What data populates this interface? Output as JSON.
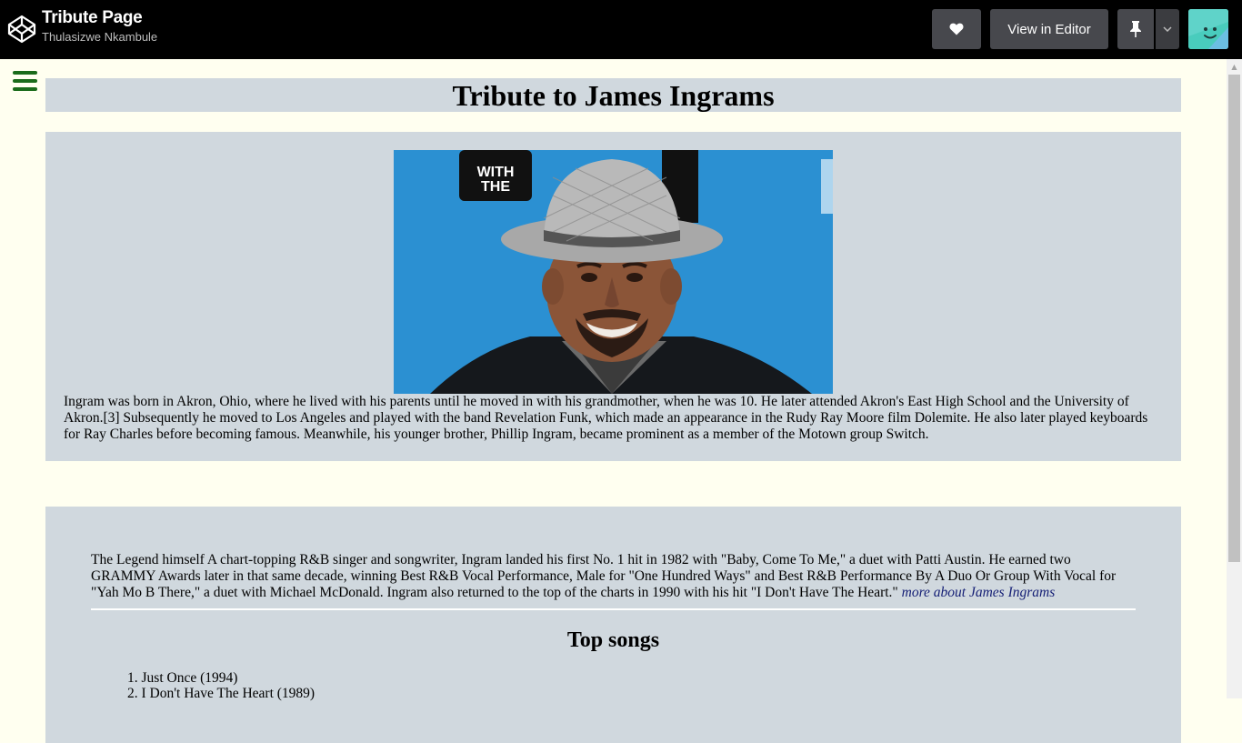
{
  "codepen": {
    "title": "Tribute Page",
    "author": "Thulasizwe Nkambule",
    "heart_icon": "heart-icon",
    "view_in_editor": "View in Editor",
    "pin_icon": "pin-icon"
  },
  "page": {
    "heading": "Tribute to James Ingrams",
    "photo_badge_line1": "WITH",
    "photo_badge_line2": "THE",
    "bio": "Ingram was born in Akron, Ohio, where he lived with his parents until he moved in with his grandmother, when he was 10. He later attended Akron's East High School and the University of Akron.[3] Subsequently he moved to Los Angeles and played with the band Revelation Funk, which made an appearance in the Rudy Ray Moore film Dolemite. He also later played keyboards for Ray Charles before becoming famous. Meanwhile, his younger brother, Phillip Ingram, became prominent as a member of the Motown group Switch.",
    "quote": "The Legend himself A chart-topping R&B singer and songwriter, Ingram landed his first No. 1 hit in 1982 with \"Baby, Come To Me,\" a duet with Patti Austin. He earned two GRAMMY Awards later in that same decade, winning Best R&B Vocal Performance, Male for \"One Hundred Ways\" and Best R&B Performance By A Duo Or Group With Vocal for \"Yah Mo B There,\" a duet with Michael McDonald. Ingram also returned to the top of the charts in 1990 with his hit \"I Don't Have The Heart.\" ",
    "more_link": "more about James Ingrams",
    "songs_title": "Top songs",
    "songs": [
      {
        "num": "1.",
        "label": "Just Once (1994)"
      },
      {
        "num": "2.",
        "label": "I Don't Have The Heart (1989)"
      }
    ]
  },
  "colors": {
    "topbar": "#000000",
    "panel": "#d0d8de",
    "page_bg": "#fffff0",
    "hamburger": "#1a6b1a",
    "link": "#141e75"
  }
}
